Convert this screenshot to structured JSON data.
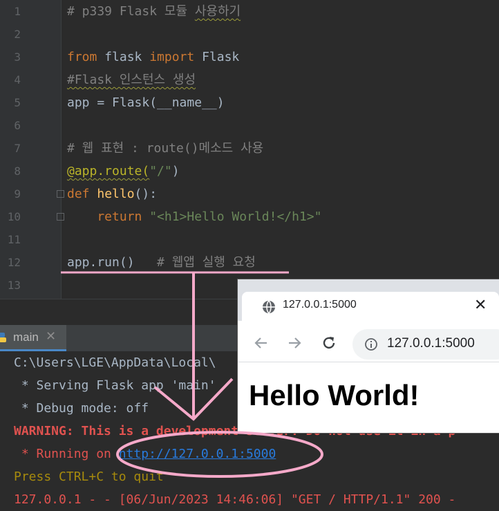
{
  "editor": {
    "line_numbers": [
      "1",
      "2",
      "3",
      "4",
      "5",
      "6",
      "7",
      "8",
      "9",
      "10",
      "11",
      "12",
      "13"
    ],
    "lines": {
      "l1_comment": "# p339 Flask 모듈 ",
      "l1_comment_sq": "사용하기",
      "l3_from": "from",
      "l3_mod": " flask ",
      "l3_import": "import",
      "l3_cls": " Flask",
      "l4_comment_sq": "#Flask 인스턴스 생성",
      "l5_code": "app = Flask(__name__)",
      "l7_comment": "# 웹 표현 : route()메소드 사용",
      "l8_deco": "@app.route(",
      "l8_str": "\"/\"",
      "l8_close": ")",
      "l9_def": "def",
      "l9_fn": " hello",
      "l9_rest": "():",
      "l10_return": "    return",
      "l10_str": " \"<h1>Hello World!</h1>\"",
      "l12_code": "app.run()",
      "l12_comment": "   # 웹앱 실행 요청"
    }
  },
  "run_panel": {
    "tab_label": "main",
    "tab_close": "✕",
    "output": [
      {
        "text": "C:\\Users\\LGE\\AppData\\Local\\",
        "color": "#a9b7c6"
      },
      {
        "text": " * Serving Flask app 'main'",
        "color": "#a9b7c6"
      },
      {
        "text": " * Debug mode: off",
        "color": "#a9b7c6"
      },
      {
        "text": "WARNING: This is a development server. Do not use it in a p",
        "color": "#e0524f"
      },
      {
        "text": " * Running on ",
        "color": "#e0524f"
      },
      {
        "text": "Press CTRL+C to quit",
        "color": "#a68a0d"
      },
      {
        "text": "127.0.0.1 - - [06/Jun/2023 14:46:06] \"GET / HTTP/1.1\" 200 -",
        "color": "#e0524f"
      }
    ],
    "run_link": "http://127.0.0.1:5000"
  },
  "browser": {
    "tab_title": "127.0.0.1:5000",
    "tab_close": "✕",
    "url": "127.0.0.1:5000",
    "page_heading": "Hello World!"
  },
  "colors": {
    "annotation": "#f5a9c9",
    "link": "#287bde"
  }
}
